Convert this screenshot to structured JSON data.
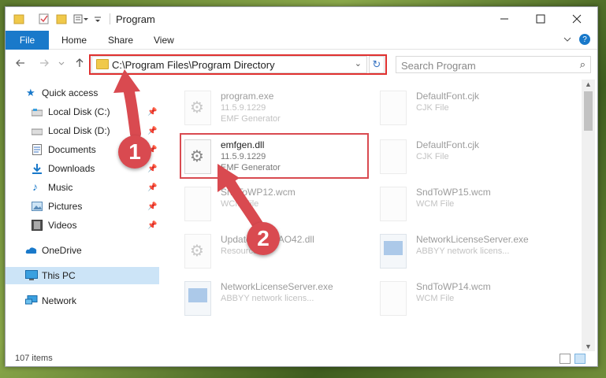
{
  "window": {
    "title": "Program"
  },
  "ribbon": {
    "file_tab": "File",
    "home_tab": "Home",
    "share_tab": "Share",
    "view_tab": "View"
  },
  "address": {
    "path": "C:\\Program Files\\Program Directory"
  },
  "search": {
    "placeholder": "Search Program"
  },
  "sidebar": {
    "items": [
      {
        "label": "Quick access",
        "icon": "star-icon"
      },
      {
        "label": "Local Disk (C:)",
        "icon": "drive-icon"
      },
      {
        "label": "Local Disk (D:)",
        "icon": "drive-icon"
      },
      {
        "label": "Documents",
        "icon": "document-icon"
      },
      {
        "label": "Downloads",
        "icon": "download-icon"
      },
      {
        "label": "Music",
        "icon": "music-icon"
      },
      {
        "label": "Pictures",
        "icon": "picture-icon"
      },
      {
        "label": "Videos",
        "icon": "video-icon"
      },
      {
        "label": "OneDrive",
        "icon": "cloud-icon"
      },
      {
        "label": "This PC",
        "icon": "computer-icon"
      },
      {
        "label": "Network",
        "icon": "network-icon"
      }
    ]
  },
  "files": [
    {
      "name": "program.exe",
      "line1": "11.5.9.1229",
      "line2": "EMF Generator"
    },
    {
      "name": "DefaultFont.cjk",
      "line1": "CJK File",
      "line2": ""
    },
    {
      "name": "emfgen.dll",
      "line1": "11.5.9.1229",
      "line2": "EMF Generator"
    },
    {
      "name": "DefaultFont.cjk",
      "line1": "CJK File",
      "line2": ""
    },
    {
      "name": "SndToWP12.wcm",
      "line1": "WCM File",
      "line2": ""
    },
    {
      "name": "SndToWP15.wcm",
      "line1": "WCM File",
      "line2": ""
    },
    {
      "name": "UpdateNoticeAO42.dll",
      "line1": "Resource...",
      "line2": ""
    },
    {
      "name": "NetworkLicenseServer.exe",
      "line1": "ABBYY network licens...",
      "line2": ""
    },
    {
      "name": "NetworkLicenseServer.exe",
      "line1": "ABBYY network licens...",
      "line2": ""
    },
    {
      "name": "SndToWP14.wcm",
      "line1": "WCM File",
      "line2": ""
    }
  ],
  "status": {
    "count": "107 items"
  },
  "callouts": {
    "one": "1",
    "two": "2"
  },
  "colors": {
    "accent": "#1979ca",
    "highlight_red": "#d94a50",
    "selected_nav": "#cce4f7"
  }
}
